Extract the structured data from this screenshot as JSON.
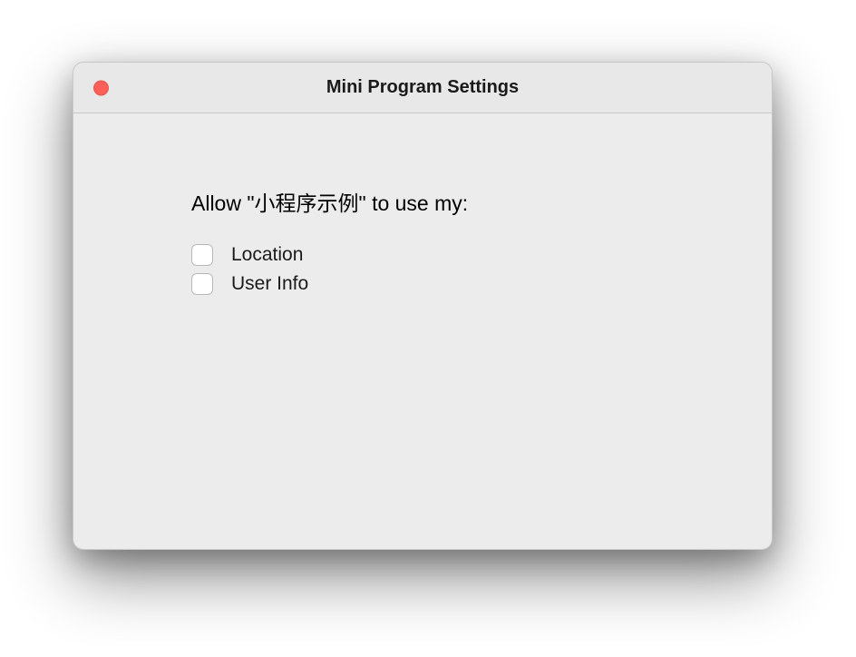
{
  "window": {
    "title": "Mini Program Settings"
  },
  "content": {
    "prompt": "Allow \"小程序示例\" to use my:",
    "permissions": [
      {
        "label": "Location",
        "checked": false
      },
      {
        "label": "User Info",
        "checked": false
      }
    ]
  }
}
